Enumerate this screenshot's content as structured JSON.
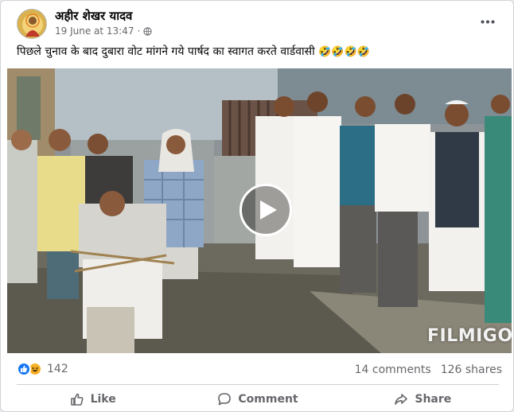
{
  "post": {
    "author": "अहीर शेखर यादव",
    "time": "19 June at 13:47",
    "separator": "·",
    "caption": "पिछले चुनाव के बाद दुबारा वोट मांगने गये पार्षद का स्वागत करते वार्डवासी",
    "caption_emojis": "🤣🤣🤣🤣",
    "more_icon": "more-horizontal-icon",
    "privacy_icon": "globe-icon"
  },
  "video": {
    "watermark": "FILMIGO",
    "play_icon": "play-icon"
  },
  "stats": {
    "reactions_count": "142",
    "reaction_icons": [
      "like-icon",
      "haha-icon"
    ],
    "comments": "14 comments",
    "shares": "126 shares"
  },
  "actions": {
    "like": "Like",
    "comment": "Comment",
    "share": "Share"
  },
  "colors": {
    "brand_blue": "#1877f2",
    "secondary_text": "#65676b",
    "haha_yellow": "#f7b125"
  }
}
